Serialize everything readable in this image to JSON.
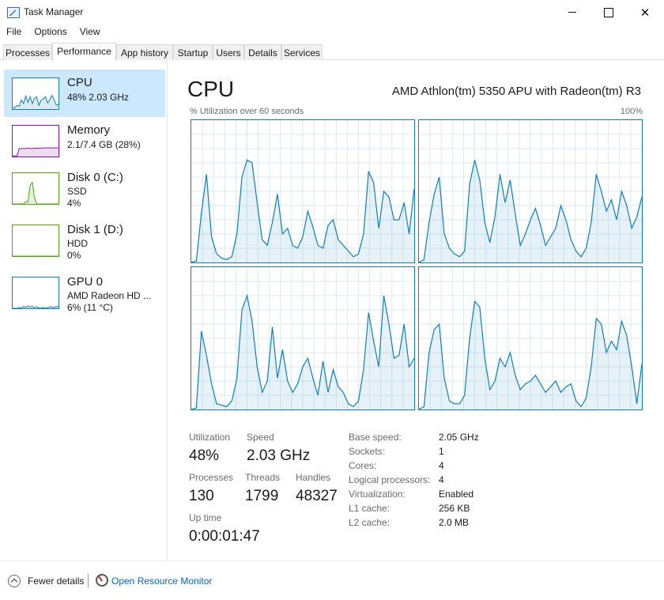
{
  "window": {
    "title": "Task Manager",
    "icon": "task-manager-icon"
  },
  "menu": [
    "File",
    "Options",
    "View"
  ],
  "tabs": [
    "Processes",
    "Performance",
    "App history",
    "Startup",
    "Users",
    "Details",
    "Services"
  ],
  "active_tab": "Performance",
  "sidebar": [
    {
      "title": "CPU",
      "sub1": "48% 2.03 GHz",
      "sub2": "",
      "sub3": "",
      "color": "#117dbb",
      "selected": true,
      "series": [
        3,
        5,
        12,
        9,
        30,
        18,
        42,
        22,
        40,
        18,
        35,
        40,
        12,
        28,
        33,
        40,
        20,
        30,
        45,
        30,
        12,
        16
      ]
    },
    {
      "title": "Memory",
      "sub1": "2.1/7.4 GB (28%)",
      "sub2": "",
      "sub3": "",
      "color": "#8b12ae",
      "selected": false,
      "series": [
        2,
        2,
        2,
        26,
        26,
        26,
        26,
        27,
        26,
        26,
        27,
        27,
        27,
        27,
        28,
        28,
        28,
        28,
        28,
        28,
        28,
        28
      ]
    },
    {
      "title": "Disk 0 (C:)",
      "sub1": "SSD",
      "sub2": "4%",
      "sub3": "",
      "color": "#4da60c",
      "selected": false,
      "series": [
        0,
        0,
        0,
        0,
        0,
        0,
        8,
        6,
        60,
        70,
        20,
        0,
        0,
        0,
        0,
        0,
        0,
        0,
        0,
        0,
        0,
        0
      ]
    },
    {
      "title": "Disk 1 (D:)",
      "sub1": "HDD",
      "sub2": "0%",
      "sub3": "",
      "color": "#4da60c",
      "selected": false,
      "series": [
        0,
        0,
        0,
        0,
        0,
        0,
        0,
        0,
        0,
        0,
        0,
        0,
        0,
        0,
        0,
        0,
        0,
        0,
        0,
        0,
        0,
        0
      ]
    },
    {
      "title": "GPU 0",
      "sub1": "AMD Radeon HD ...",
      "sub2": "6% (11 °C)",
      "sub3": "",
      "color": "#117dbb",
      "selected": false,
      "series": [
        0,
        0,
        0,
        2,
        1,
        6,
        3,
        8,
        4,
        6,
        2,
        5,
        1,
        0,
        3,
        0,
        2,
        5,
        4,
        2,
        6,
        4
      ]
    }
  ],
  "cpu": {
    "title": "CPU",
    "model": "AMD Athlon(tm) 5350 APU with Radeon(tm) R3",
    "util_label": "% Utilization over 60 seconds",
    "util_max": "100%",
    "cores": [
      {
        "name": "core-0",
        "values": [
          0,
          1,
          35,
          62,
          18,
          6,
          3,
          2,
          4,
          20,
          60,
          72,
          70,
          42,
          16,
          12,
          28,
          48,
          20,
          24,
          12,
          10,
          18,
          36,
          25,
          12,
          10,
          26,
          30,
          16,
          12,
          8,
          4,
          6,
          20,
          64,
          56,
          24,
          50,
          46,
          30,
          30,
          42,
          20,
          52
        ]
      },
      {
        "name": "core-1",
        "values": [
          0,
          2,
          28,
          48,
          60,
          20,
          10,
          6,
          4,
          8,
          55,
          72,
          58,
          28,
          14,
          32,
          62,
          42,
          58,
          34,
          12,
          20,
          30,
          38,
          26,
          12,
          18,
          24,
          40,
          30,
          16,
          8,
          4,
          10,
          28,
          62,
          50,
          36,
          44,
          30,
          50,
          40,
          24,
          32,
          46
        ]
      },
      {
        "name": "core-2",
        "values": [
          0,
          1,
          55,
          38,
          18,
          4,
          3,
          2,
          6,
          22,
          70,
          80,
          62,
          30,
          12,
          20,
          58,
          22,
          42,
          20,
          12,
          18,
          30,
          36,
          22,
          10,
          34,
          12,
          28,
          16,
          12,
          4,
          2,
          6,
          28,
          68,
          48,
          30,
          80,
          60,
          36,
          38,
          60,
          30,
          36
        ]
      },
      {
        "name": "core-3",
        "values": [
          0,
          2,
          40,
          56,
          60,
          22,
          6,
          4,
          4,
          10,
          50,
          76,
          72,
          36,
          14,
          20,
          36,
          30,
          40,
          24,
          14,
          18,
          20,
          24,
          18,
          12,
          16,
          20,
          12,
          16,
          18,
          6,
          2,
          8,
          30,
          64,
          60,
          40,
          48,
          42,
          62,
          52,
          30,
          4,
          32
        ]
      }
    ],
    "stats": {
      "utilization_label": "Utilization",
      "utilization": "48%",
      "speed_label": "Speed",
      "speed": "2.03 GHz",
      "processes_label": "Processes",
      "processes": "130",
      "threads_label": "Threads",
      "threads": "1799",
      "handles_label": "Handles",
      "handles": "48327",
      "uptime_label": "Up time",
      "uptime": "0:00:01:47"
    },
    "info": [
      {
        "label": "Base speed:",
        "value": "2.05 GHz"
      },
      {
        "label": "Sockets:",
        "value": "1"
      },
      {
        "label": "Cores:",
        "value": "4"
      },
      {
        "label": "Logical processors:",
        "value": "4"
      },
      {
        "label": "Virtualization:",
        "value": "Enabled"
      },
      {
        "label": "L1 cache:",
        "value": "256 KB"
      },
      {
        "label": "L2 cache:",
        "value": "2.0 MB"
      }
    ]
  },
  "bottom": {
    "fewer_details": "Fewer details",
    "open_resource_monitor": "Open Resource Monitor"
  }
}
